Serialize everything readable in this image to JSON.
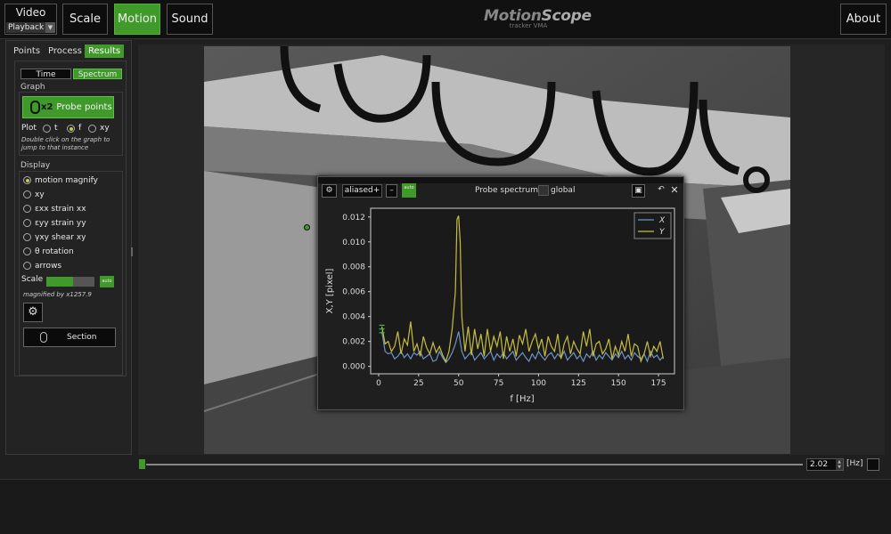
{
  "topbar": {
    "video_label": "Video",
    "video_select": "Playback",
    "tabs": [
      "Scale",
      "Motion",
      "Sound"
    ],
    "active_tab": "Motion",
    "logo_title_a": "Motion",
    "logo_title_b": "Scope",
    "logo_sub": "tracker VMA",
    "about_label": "About"
  },
  "leftpanel": {
    "tabs": [
      "Points",
      "Process",
      "Results"
    ],
    "active_tab": "Results",
    "subtabs": [
      "Time",
      "Spectrum"
    ],
    "active_subtab": "Spectrum",
    "graph_title": "Graph",
    "probe_button_x2": "x2",
    "probe_button_label": "Probe points",
    "plot_label": "Plot",
    "plot_options": [
      "t",
      "f",
      "xy"
    ],
    "plot_selected": "f",
    "hint": "Double click on the graph to jump to that instance",
    "display_title": "Display",
    "display_options": [
      "motion magnify",
      "xy",
      "εxx strain xx",
      "εyy strain yy",
      "γxy shear xy",
      "θ  rotation",
      "arrows"
    ],
    "display_selected": "motion magnify",
    "scale_label": "Scale",
    "scale_level": 0.55,
    "scale_auto": "auto",
    "magnified": "magnified by x1257.9",
    "section_label": "Section"
  },
  "spectrum_window": {
    "aliased_value": "aliased+",
    "minus_label": "–",
    "auto_label": "auto",
    "title": "Probe spectrum",
    "global_label": "global"
  },
  "chart_data": {
    "type": "line",
    "xlabel": "f [Hz]",
    "ylabel": "X,Y [pixel]",
    "xlim": [
      -5,
      185
    ],
    "ylim": [
      -0.0006,
      0.0127
    ],
    "xticks": [
      "0",
      "25",
      "50",
      "75",
      "100",
      "125",
      "150",
      "175"
    ],
    "yticks": [
      "0.000",
      "0.002",
      "0.004",
      "0.006",
      "0.008",
      "0.010",
      "0.012"
    ],
    "legend_position": "top-right",
    "series": [
      {
        "name": "X",
        "color": "#6f93c4",
        "x": [
          2,
          4,
          6,
          8,
          10,
          12,
          14,
          16,
          18,
          20,
          22,
          24,
          26,
          28,
          30,
          32,
          34,
          36,
          38,
          40,
          42,
          44,
          46,
          48,
          50,
          52,
          54,
          56,
          58,
          60,
          62,
          64,
          66,
          68,
          70,
          72,
          74,
          76,
          78,
          80,
          82,
          84,
          86,
          88,
          90,
          92,
          94,
          96,
          98,
          100,
          102,
          104,
          106,
          108,
          110,
          112,
          114,
          116,
          118,
          120,
          122,
          124,
          126,
          128,
          130,
          132,
          134,
          136,
          138,
          140,
          142,
          144,
          146,
          148,
          150,
          152,
          154,
          156,
          158,
          160,
          162,
          164,
          166,
          168,
          170,
          172,
          174,
          176,
          178
        ],
        "values": [
          0.0028,
          0.0012,
          0.001,
          0.0011,
          0.0006,
          0.0008,
          0.0012,
          0.0007,
          0.001,
          0.0006,
          0.0011,
          0.0009,
          0.0012,
          0.0006,
          0.0008,
          0.001,
          0.0004,
          0.0005,
          0.0012,
          0.0007,
          0.0003,
          0.0006,
          0.0011,
          0.0018,
          0.0028,
          0.0012,
          0.0006,
          0.0009,
          0.0012,
          0.0005,
          0.0008,
          0.0011,
          0.0006,
          0.0009,
          0.0012,
          0.0005,
          0.001,
          0.0007,
          0.0011,
          0.0006,
          0.0009,
          0.0012,
          0.0005,
          0.0008,
          0.0011,
          0.0007,
          0.0004,
          0.001,
          0.0006,
          0.0012,
          0.0008,
          0.0005,
          0.0009,
          0.0011,
          0.0006,
          0.001,
          0.0007,
          0.0012,
          0.0005,
          0.0008,
          0.0011,
          0.0006,
          0.0009,
          0.0004,
          0.001,
          0.0007,
          0.0012,
          0.0005,
          0.0009,
          0.0006,
          0.0011,
          0.0008,
          0.0005,
          0.001,
          0.0007,
          0.0012,
          0.0006,
          0.0009,
          0.0005,
          0.0011,
          0.0008,
          0.0006,
          0.001,
          0.0004,
          0.0012,
          0.0007,
          0.0009,
          0.0005,
          0.0008
        ]
      },
      {
        "name": "Y",
        "color": "#c6bd3f",
        "x": [
          2,
          4,
          6,
          8,
          10,
          12,
          14,
          16,
          18,
          20,
          22,
          24,
          26,
          28,
          30,
          32,
          34,
          36,
          38,
          40,
          42,
          44,
          46,
          48,
          49,
          50,
          51,
          52,
          54,
          56,
          58,
          60,
          62,
          64,
          66,
          68,
          70,
          72,
          74,
          76,
          78,
          80,
          82,
          84,
          86,
          88,
          90,
          92,
          94,
          96,
          98,
          100,
          102,
          104,
          106,
          108,
          110,
          112,
          114,
          116,
          118,
          120,
          122,
          124,
          126,
          128,
          130,
          132,
          134,
          136,
          138,
          140,
          142,
          144,
          146,
          148,
          150,
          152,
          154,
          156,
          158,
          160,
          162,
          164,
          166,
          168,
          170,
          172,
          174,
          176,
          178
        ],
        "values": [
          0.0032,
          0.0018,
          0.002,
          0.0012,
          0.0016,
          0.0028,
          0.001,
          0.0022,
          0.0017,
          0.0036,
          0.0012,
          0.0018,
          0.0008,
          0.0024,
          0.0015,
          0.001,
          0.0019,
          0.0011,
          0.0016,
          0.0009,
          0.0004,
          0.0012,
          0.003,
          0.006,
          0.0118,
          0.0121,
          0.01,
          0.004,
          0.0012,
          0.0032,
          0.0009,
          0.003,
          0.0014,
          0.0026,
          0.0008,
          0.003,
          0.0012,
          0.0024,
          0.0016,
          0.0028,
          0.0006,
          0.0024,
          0.0012,
          0.0022,
          0.0008,
          0.0025,
          0.0018,
          0.003,
          0.0012,
          0.002,
          0.0026,
          0.0014,
          0.0022,
          0.0008,
          0.0024,
          0.0016,
          0.0012,
          0.0026,
          0.0006,
          0.0018,
          0.0024,
          0.001,
          0.002,
          0.0014,
          0.001,
          0.0028,
          0.0016,
          0.003,
          0.0008,
          0.0018,
          0.002,
          0.001,
          0.0014,
          0.0022,
          0.0006,
          0.0016,
          0.0009,
          0.002,
          0.0012,
          0.0026,
          0.0008,
          0.0018,
          0.0016,
          0.0004,
          0.001,
          0.002,
          0.0008,
          0.0016,
          0.0012,
          0.002,
          0.0006
        ]
      }
    ]
  },
  "timeline": {
    "position": 0.0,
    "hz_value": "2.02",
    "unit": "[Hz]"
  }
}
